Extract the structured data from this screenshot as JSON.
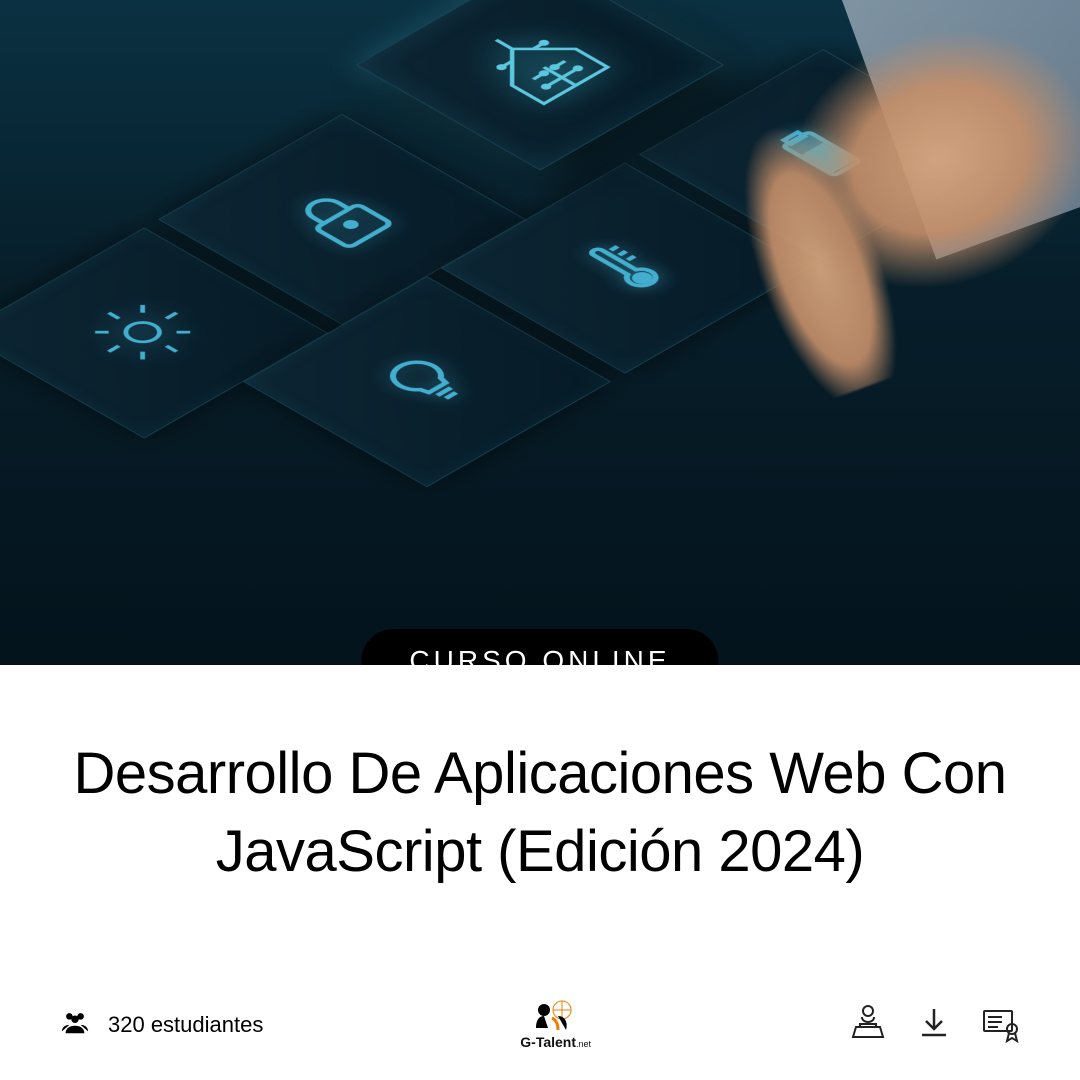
{
  "badge": {
    "label": "CURSO ONLINE"
  },
  "course": {
    "title": "Desarrollo De Aplicaciones Web Con JavaScript (Edición 2024)"
  },
  "students": {
    "count_label": "320 estudiantes"
  },
  "brand": {
    "name_main": "G-Talent",
    "name_suffix": ".net"
  },
  "hero_tiles": [
    {
      "icon": "gear-icon"
    },
    {
      "icon": "lock-icon"
    },
    {
      "icon": "house-circuit-icon"
    },
    {
      "icon": "lightbulb-icon"
    },
    {
      "icon": "thermometer-icon"
    },
    {
      "icon": "battery-icon"
    }
  ],
  "feature_icons": [
    {
      "name": "laptop-user-icon"
    },
    {
      "name": "download-icon"
    },
    {
      "name": "certificate-icon"
    }
  ]
}
